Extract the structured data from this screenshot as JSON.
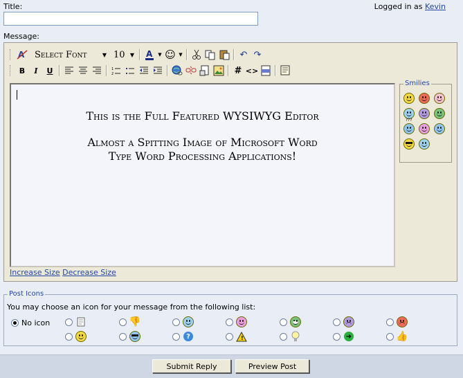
{
  "title_label": "Title:",
  "title_value": "",
  "logged_in_prefix": "Logged in as",
  "logged_in_user": "Kevin",
  "message_label": "Message:",
  "toolbar": {
    "font_select": "Select Font",
    "size_select": "10"
  },
  "editor": {
    "line1": "This is the Full Featured WYSIWYG Editor",
    "line2": "Almost a Spitting Image of Microsoft Word",
    "line3": "Type Word Processing Applications!"
  },
  "smilies": {
    "legend": "Smilies",
    "colors": [
      "#f5d942",
      "#f06a5a",
      "#f8c0cc",
      "#9cd2f0",
      "#b39be0",
      "#7ac47a",
      "#8fc6f0",
      "#e99ee0",
      "#8fc6f0",
      "#f5d942",
      "#9cd2f0"
    ],
    "confused_label": "???"
  },
  "size_links": {
    "increase": "Increase Size",
    "decrease": "Decrease Size"
  },
  "post_icons": {
    "legend": "Post Icons",
    "instructions": "You may choose an icon for your message from the following list:",
    "no_icon": "No icon"
  },
  "buttons": {
    "submit": "Submit Reply",
    "preview": "Preview Post"
  }
}
